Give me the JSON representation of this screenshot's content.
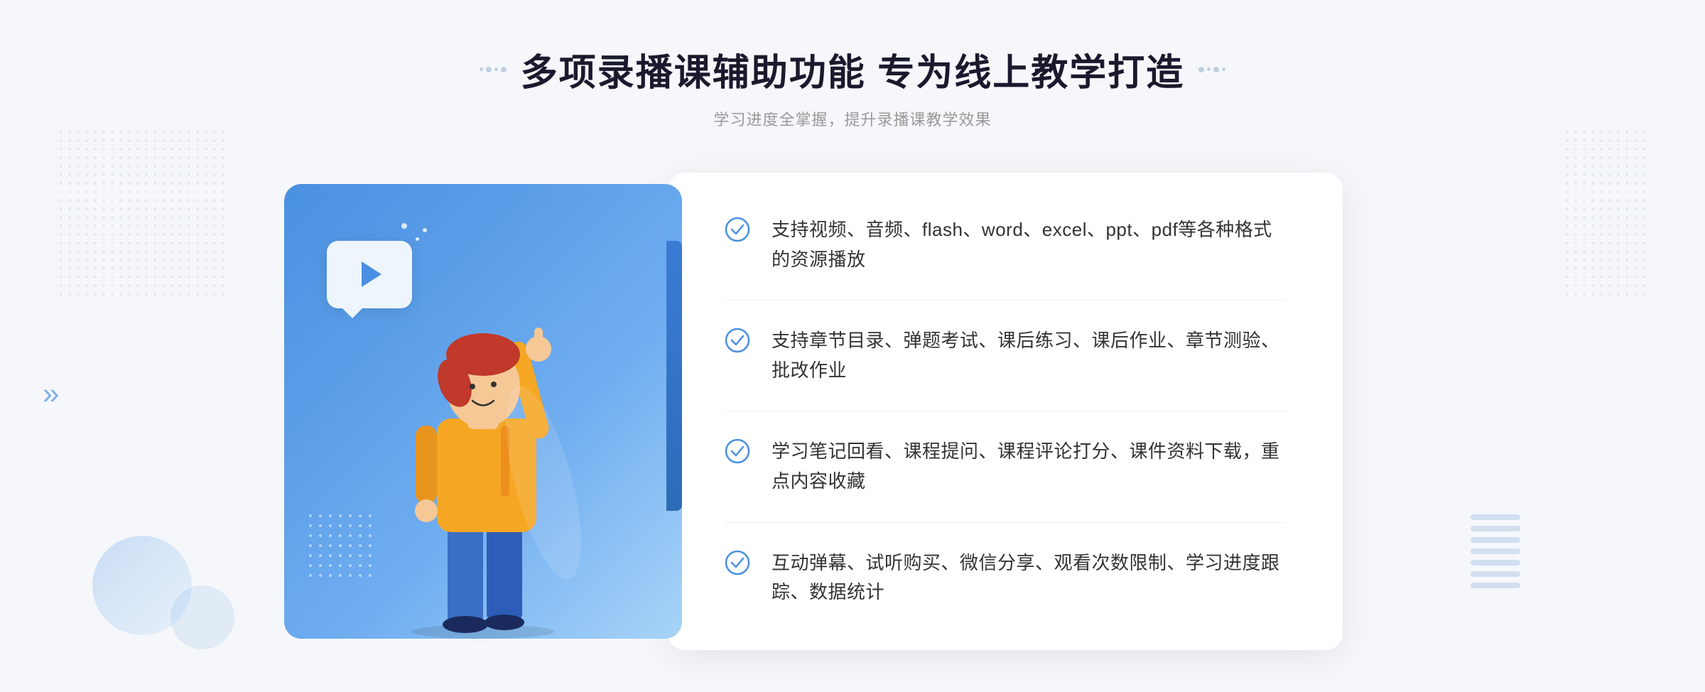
{
  "header": {
    "title": "多项录播课辅助功能 专为线上教学打造",
    "subtitle": "学习进度全掌握，提升录播课教学效果",
    "deco_left": "❖",
    "deco_right": "❖"
  },
  "features": [
    {
      "id": "feature-1",
      "text": "支持视频、音频、flash、word、excel、ppt、pdf等各种格式的资源播放"
    },
    {
      "id": "feature-2",
      "text": "支持章节目录、弹题考试、课后练习、课后作业、章节测验、批改作业"
    },
    {
      "id": "feature-3",
      "text": "学习笔记回看、课程提问、课程评论打分、课件资料下载，重点内容收藏"
    },
    {
      "id": "feature-4",
      "text": "互动弹幕、试听购买、微信分享、观看次数限制、学习进度跟踪、数据统计"
    }
  ],
  "colors": {
    "primary": "#4a90e2",
    "title": "#1a1a2e",
    "text": "#333333",
    "subtitle": "#999999",
    "check": "#4a90e2"
  }
}
